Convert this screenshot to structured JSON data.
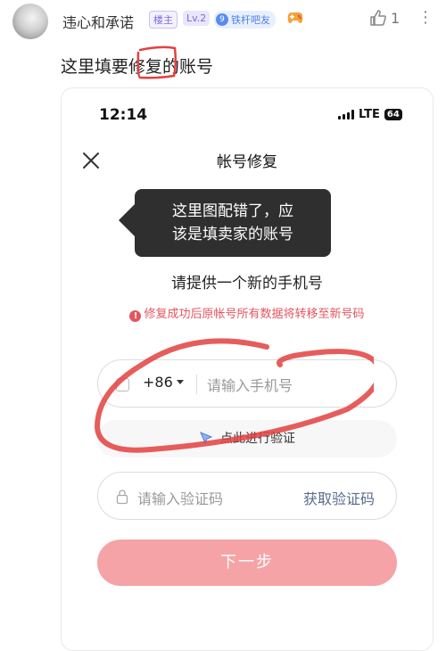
{
  "post": {
    "username": "违心和承诺",
    "badge_owner": "楼主",
    "badge_level": "Lv.2",
    "fan_level": "9",
    "fan_label": "铁杆吧友",
    "like_count": "1",
    "text_before": "这里填要",
    "text_highlight": "修复",
    "text_after": "的账号"
  },
  "phone": {
    "status_time": "12:14",
    "status_network": "LTE",
    "battery": "64",
    "title": "帐号修复",
    "tooltip_line1": "这里图配错了，应",
    "tooltip_line2": "该是填卖家的账号",
    "heading": "请提供一个新的手机号",
    "warning": "修复成功后原帐号所有数据将转移至新号码",
    "country_code": "+86",
    "phone_placeholder": "请输入手机号",
    "verify_label": "点此进行验证",
    "code_placeholder": "请输入验证码",
    "get_code_label": "获取验证码",
    "next_label": "下一步"
  },
  "icons": {
    "like": "thumbs-up-icon",
    "more": "more-vertical-icon",
    "close": "close-icon",
    "lock": "lock-icon",
    "warning": "exclamation-circle-icon",
    "cursor": "cursor-icon"
  },
  "colors": {
    "accent_red": "#e5555e",
    "button_disabled": "#f5a3a7",
    "annotation_red": "#e2413f"
  }
}
